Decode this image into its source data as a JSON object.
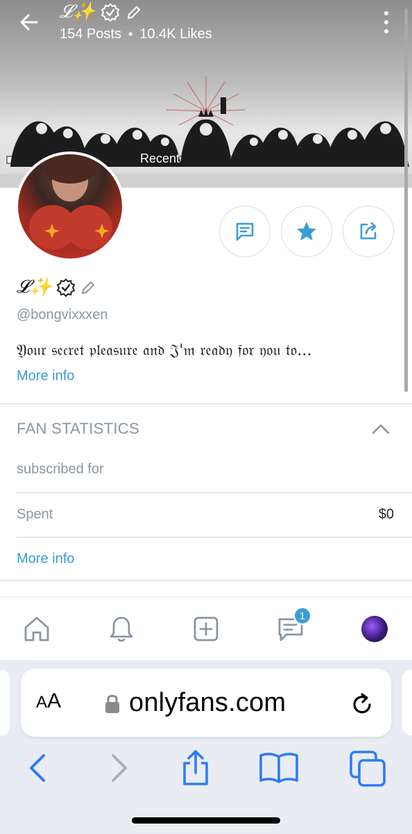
{
  "profile": {
    "display_name": "𝓛✨",
    "posts_count": "154 Posts",
    "likes_count": "10.4K Likes",
    "separator": "•",
    "handle": "@bongvixxxen",
    "bio": "𝔜𝔬𝔲𝔯 𝔰𝔢𝔠𝔯𝔢𝔱 𝔭𝔩𝔢𝔞𝔰𝔲𝔯𝔢 𝔞𝔫𝔡 𝔍'𝔪 𝔯𝔢𝔞𝔡𝔶 𝔣𝔬𝔯 𝔶𝔬𝔲 𝔱𝔬...",
    "more_info_label": "More info",
    "cover_label": "Recent"
  },
  "fan_statistics": {
    "header": "FAN STATISTICS",
    "subscribed_label": "subscribed for",
    "spent_label": "Spent",
    "spent_value": "$0",
    "more_info_label": "More info"
  },
  "bottom_nav": {
    "items": [
      {
        "name": "home",
        "icon": "home-icon"
      },
      {
        "name": "notifications",
        "icon": "bell-icon"
      },
      {
        "name": "new-post",
        "icon": "plus-square-icon"
      },
      {
        "name": "messages",
        "icon": "message-icon",
        "badge": "1"
      },
      {
        "name": "profile",
        "icon": "avatar"
      }
    ]
  },
  "browser": {
    "aa_big": "A",
    "aa_small": "A",
    "url": "onlyfans.com"
  },
  "colors": {
    "accent": "#3a9ed6",
    "muted_text": "#8a96a3",
    "divider": "#e3e6ea",
    "safari_bg": "#e9edf3",
    "toolbar_blue": "#2e7cf6"
  }
}
